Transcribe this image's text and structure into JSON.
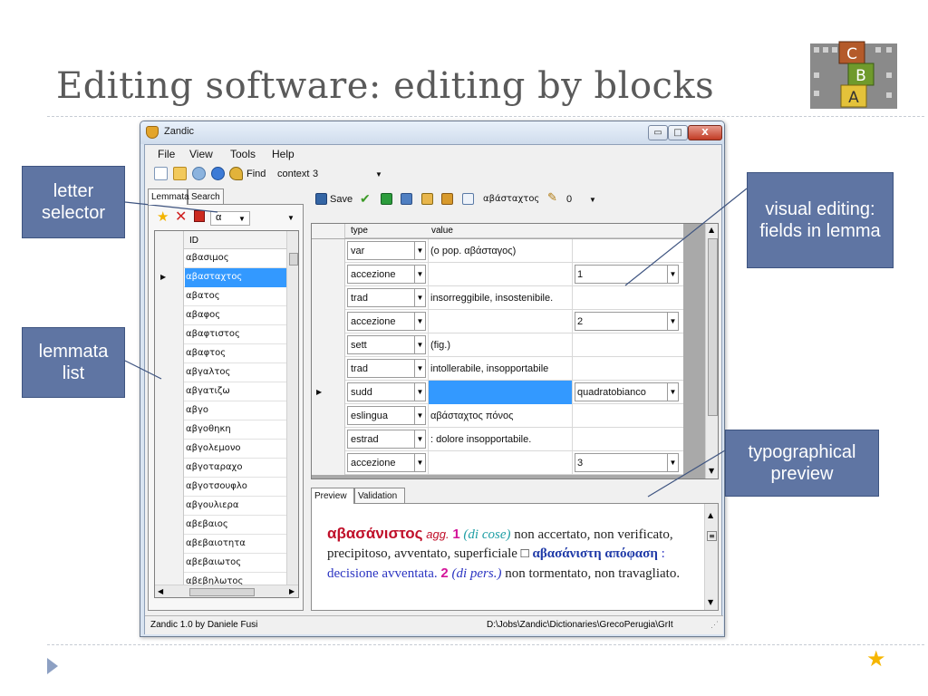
{
  "slide": {
    "title": "Editing software: editing by blocks",
    "logo_letters": [
      "C",
      "B",
      "A"
    ]
  },
  "callouts": {
    "letter_selector": "letter selector",
    "lemmata_list": "lemmata list",
    "visual_editing": "visual editing: fields in lemma",
    "typographical_preview": "typographical preview"
  },
  "window": {
    "title": "Zandic",
    "controls": {
      "minimize": "▭",
      "maximize": "□",
      "close": "X"
    }
  },
  "menu": [
    "File",
    "View",
    "Tools",
    "Help"
  ],
  "toolbar": {
    "find_label": "Find",
    "context_label": "context",
    "context_value": "3"
  },
  "left_tabs": [
    "Lemmata",
    "Search"
  ],
  "letter_selector_value": "α",
  "lemma_list": {
    "header": "ID",
    "items": [
      "αβασιμος",
      "αβασταχτος",
      "αβατος",
      "αβαφος",
      "αβαφτιστος",
      "αβαφτος",
      "αβγαλτος",
      "αβγατιζω",
      "αβγο",
      "αβγοθηκη",
      "αβγολεμονο",
      "αβγοταραχο",
      "αβγοτσουφλο",
      "αβγουλιερα",
      "αβεβαιος",
      "αβεβαιοτητα",
      "αβεβαιωτος",
      "αβεβηλωτος"
    ],
    "selected_index": 1
  },
  "editor_toolbar": {
    "save_label": "Save",
    "current_lemma": "αβάσταχτος",
    "counter_value": "0"
  },
  "fields_grid": {
    "columns": [
      "type",
      "value"
    ],
    "rows": [
      {
        "type": "var",
        "value": "(o pop. αβάσταγος)",
        "extra": ""
      },
      {
        "type": "accezione",
        "value": "",
        "extra": "1"
      },
      {
        "type": "trad",
        "value": "insorreggibile, insostenibile.",
        "extra": ""
      },
      {
        "type": "accezione",
        "value": "",
        "extra": "2"
      },
      {
        "type": "sett",
        "value": "(fig.)",
        "extra": ""
      },
      {
        "type": "trad",
        "value": "intollerabile, insopportabile",
        "extra": ""
      },
      {
        "type": "sudd",
        "value": "",
        "extra": "quadratobianco"
      },
      {
        "type": "eslingua",
        "value": "αβάσταχτος πόνος",
        "extra": ""
      },
      {
        "type": "estrad",
        "value": ": dolore insopportabile.",
        "extra": ""
      },
      {
        "type": "accezione",
        "value": "",
        "extra": "3"
      }
    ],
    "selected_index": 6
  },
  "preview_tabs": [
    "Preview",
    "Validation"
  ],
  "preview": {
    "lemma": "αβασάνιστος",
    "pos": "agg.",
    "num1": "1",
    "gloss1": "(di cose)",
    "text1": "non accertato, non verificato, precipitoso, avventato, superficiale □",
    "example": "αβασάνιστη απόφαση",
    "text2": ": decisione avventata.",
    "num2": "2",
    "gloss2": "(di pers.)",
    "text3": "non tormentato, non travagliato."
  },
  "status": {
    "left": "Zandic 1.0 by Daniele Fusi",
    "right": "D:\\Jobs\\Zandic\\Dictionaries\\GrecoPerugia\\GrIt"
  },
  "colors": {
    "callout_bg": "#5f75a3",
    "selection": "#3399ff",
    "lemma_red": "#c0102a",
    "number_magenta": "#d4149a",
    "star": "#f6b600"
  }
}
